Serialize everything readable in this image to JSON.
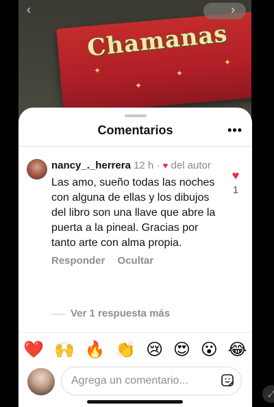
{
  "background": {
    "box_text": "Chamanas",
    "nav_left": "‹",
    "nav_right": "›"
  },
  "sheet": {
    "title": "Comentarios",
    "more": "•••"
  },
  "comment": {
    "username": "nancy_._herrera",
    "time": "12 h",
    "separator": "·",
    "by_author": "del autor",
    "text": "Las amo, sueño todas las noches con alguna de ellas y los dibujos del libro son una llave que abre la puerta a la pineal. Gracias por tanto arte con alma propia.",
    "reply_label": "Responder",
    "hide_label": "Ocultar",
    "like_count": "1"
  },
  "replies": {
    "label": "Ver 1 respuesta más"
  },
  "emojis": [
    "❤️",
    "🙌",
    "🔥",
    "👏",
    "😢",
    "😍",
    "😮",
    "😂"
  ],
  "composer": {
    "placeholder": "Agrega un comentario..."
  },
  "colors": {
    "accent_heart": "#ed2b45",
    "muted_text": "#8e8e8e"
  }
}
